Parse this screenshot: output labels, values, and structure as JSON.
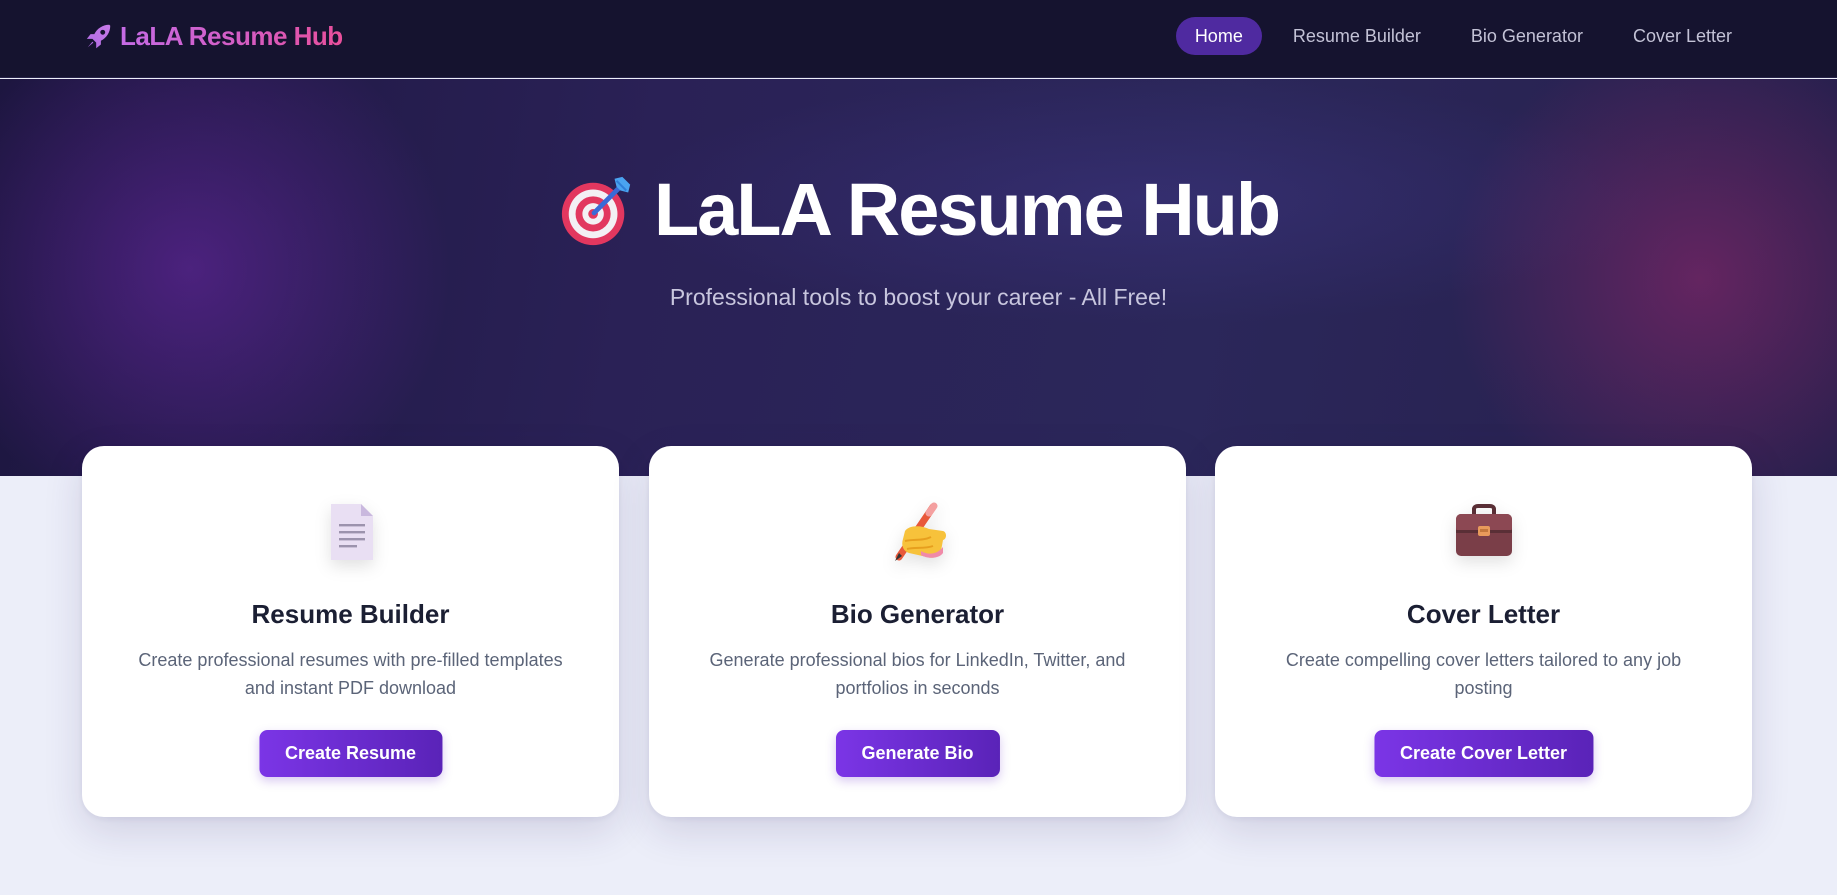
{
  "navbar": {
    "brand": "LaLA Resume Hub",
    "brand_icon": "rocket-icon",
    "links": [
      {
        "label": "Home",
        "active": true
      },
      {
        "label": "Resume Builder",
        "active": false
      },
      {
        "label": "Bio Generator",
        "active": false
      },
      {
        "label": "Cover Letter",
        "active": false
      }
    ]
  },
  "hero": {
    "icon": "target-icon",
    "title": "LaLA Resume Hub",
    "subtitle": "Professional tools to boost your career - All Free!"
  },
  "cards": [
    {
      "icon": "document-icon",
      "title": "Resume Builder",
      "description": "Create professional resumes with pre-filled templates and instant PDF download",
      "button": "Create Resume"
    },
    {
      "icon": "writing-hand-icon",
      "title": "Bio Generator",
      "description": "Generate professional bios for LinkedIn, Twitter, and portfolios in seconds",
      "button": "Generate Bio"
    },
    {
      "icon": "briefcase-icon",
      "title": "Cover Letter",
      "description": "Create compelling cover letters tailored to any job posting",
      "button": "Create Cover Letter"
    }
  ],
  "colors": {
    "accent": "#6b2fd6",
    "nav_background": "#15132f",
    "page_background": "#eceef9"
  }
}
